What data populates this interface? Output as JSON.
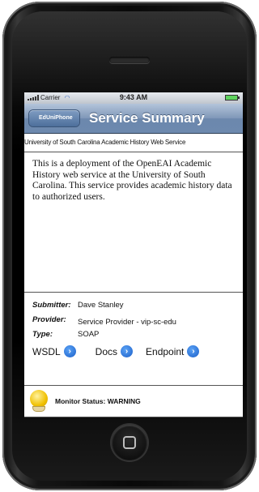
{
  "statusbar": {
    "carrier": "Carrier",
    "time": "9:43 AM",
    "wifi_icon": "wifi-icon",
    "battery_icon": "battery-icon"
  },
  "navbar": {
    "back_label": "EdUniPhone",
    "title": "Service Summary"
  },
  "service": {
    "name": "University of South Carolina Academic History Web Service",
    "description": "This is a deployment of the OpenEAI Academic History web service at the University of South Carolina. This service provides academic history data to authorized users."
  },
  "details": {
    "submitter_label": "Submitter:",
    "submitter_value": "Dave Stanley",
    "provider_label": "Provider:",
    "provider_value": "Service Provider - vip-sc-edu",
    "type_label": "Type:",
    "type_value": "SOAP"
  },
  "links": {
    "wsdl": "WSDL",
    "docs": "Docs",
    "endpoint": "Endpoint"
  },
  "monitor": {
    "status_text": "Monitor Status: WARNING",
    "status_color": "#f0c000",
    "icon": "warning-lightbulb-icon"
  }
}
